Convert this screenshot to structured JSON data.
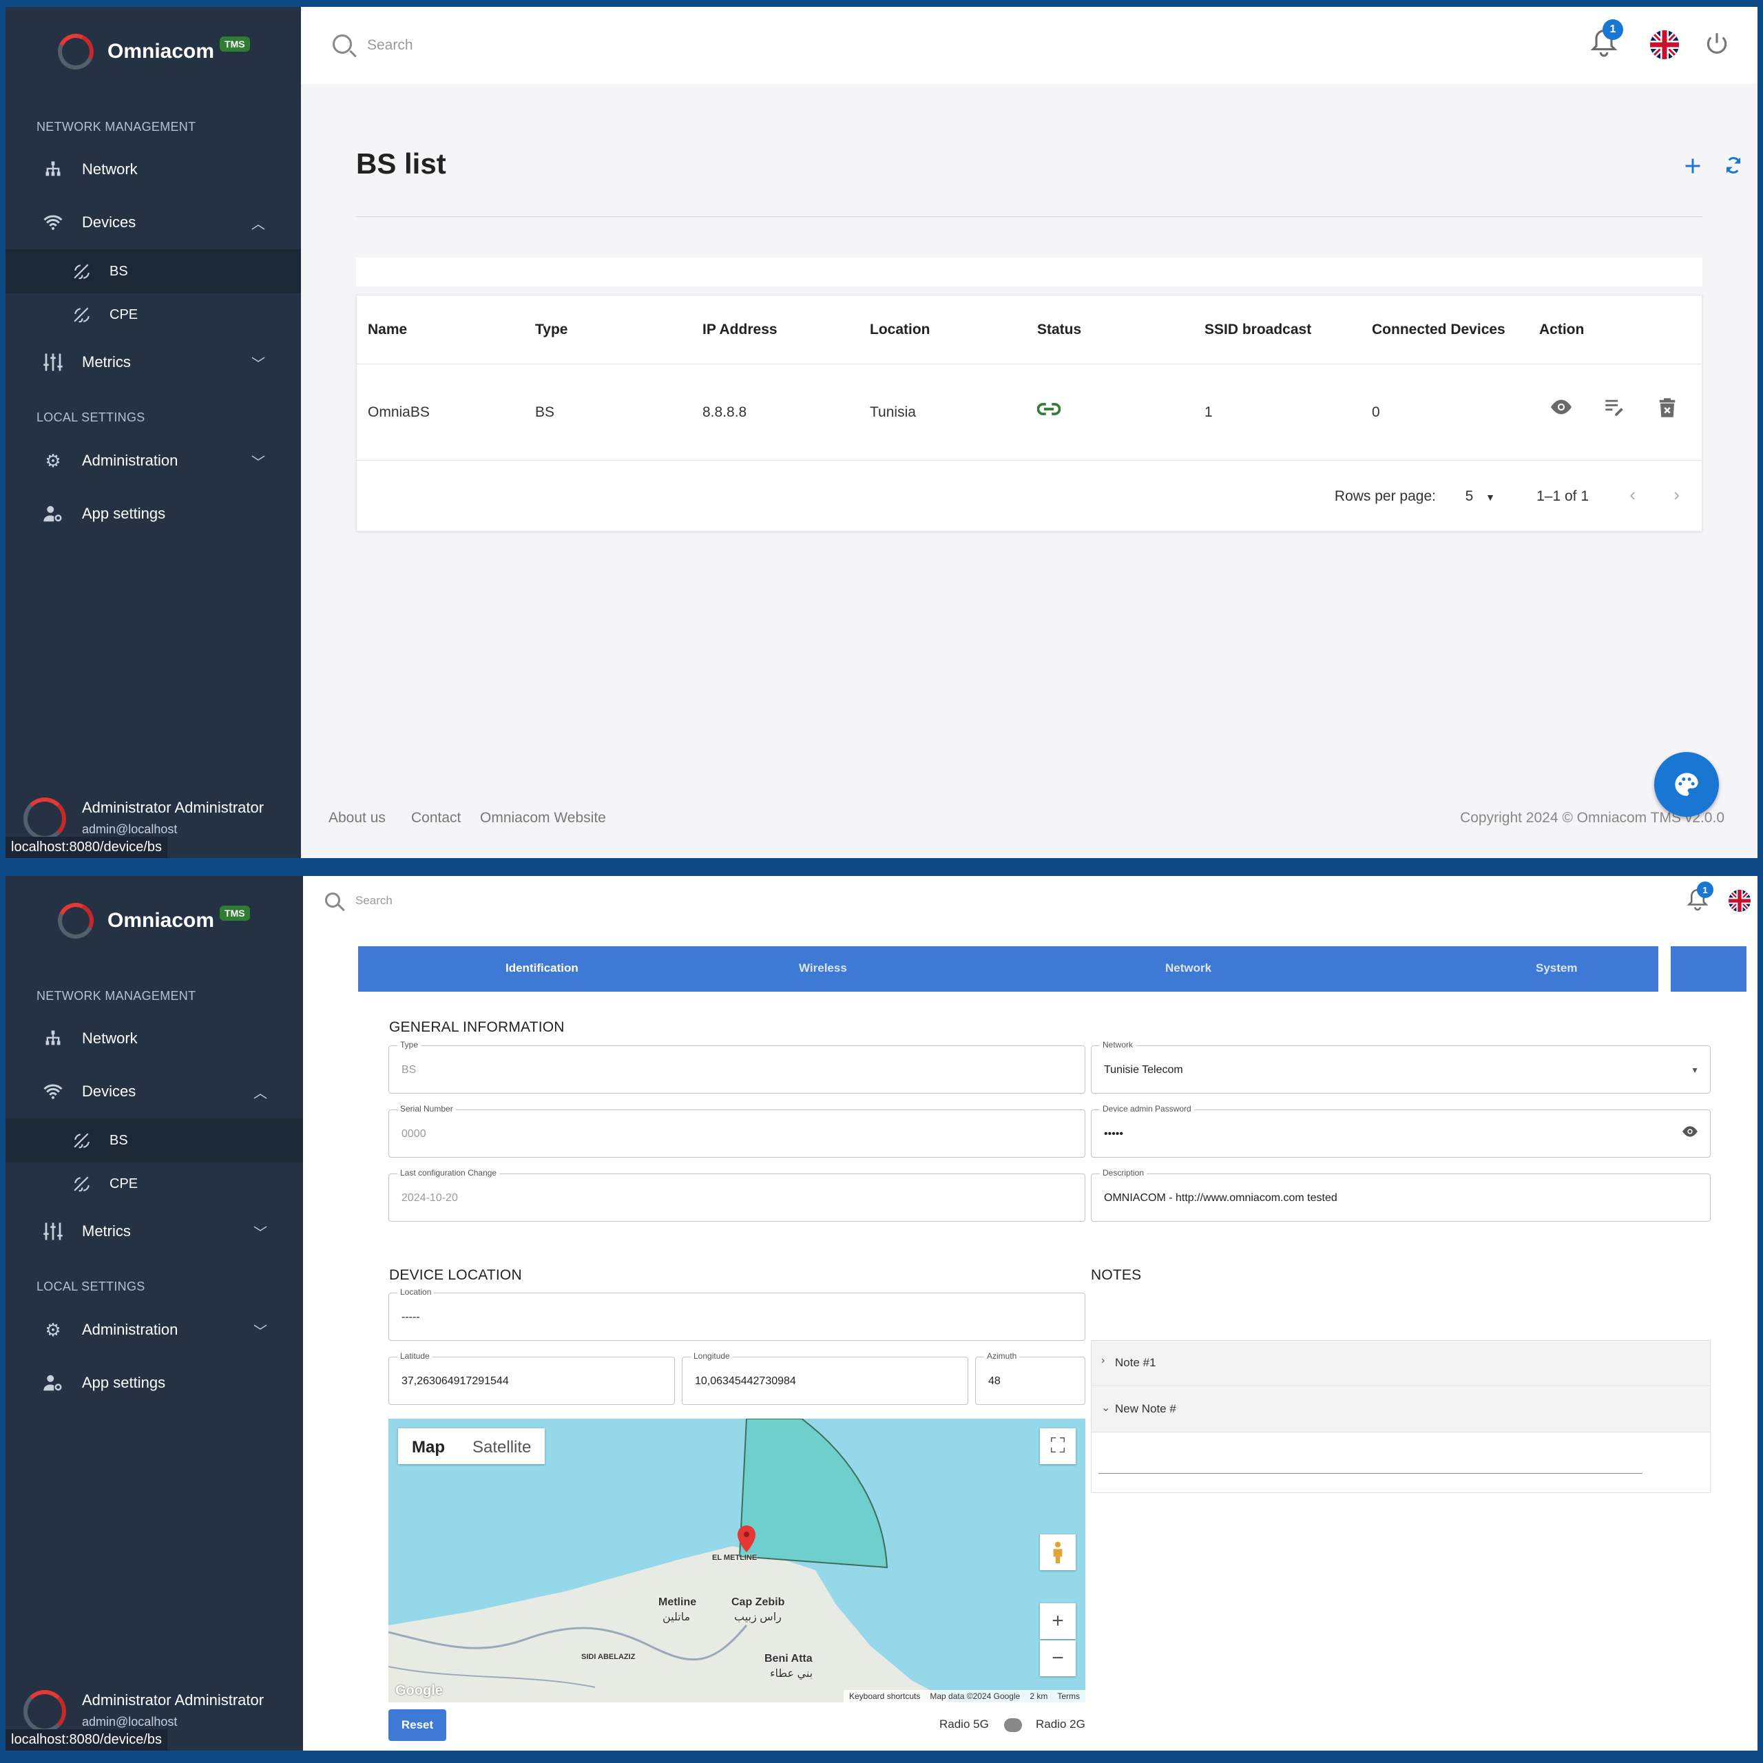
{
  "app": {
    "name": "Omniacom",
    "badge": "TMS"
  },
  "sidebar": {
    "section_network": "NETWORK MANAGEMENT",
    "section_local": "LOCAL SETTINGS",
    "items": {
      "network": "Network",
      "devices": "Devices",
      "bs": "BS",
      "cpe": "CPE",
      "metrics": "Metrics",
      "administration": "Administration",
      "app_settings": "App settings"
    },
    "user": {
      "name": "Administrator Administrator",
      "email": "admin@localhost"
    }
  },
  "status_url": "localhost:8080/device/bs",
  "topbar": {
    "search_placeholder": "Search",
    "notifications": "1"
  },
  "bs_list": {
    "title": "BS list",
    "columns": [
      "Name",
      "Type",
      "IP Address",
      "Location",
      "Status",
      "SSID broadcast",
      "Connected Devices",
      "Action"
    ],
    "rows": [
      {
        "name": "OmniaBS",
        "type": "BS",
        "ip": "8.8.8.8",
        "location": "Tunisia",
        "status": "connected",
        "ssid": "1",
        "connected": "0"
      }
    ],
    "pagination": {
      "rows_label": "Rows per page:",
      "rows_value": "5",
      "range": "1–1 of 1"
    }
  },
  "footer": {
    "links": [
      "About us",
      "Contact",
      "Omniacom Website"
    ],
    "copyright": "Copyright 2024 © Omniacom TMS v2.0.0"
  },
  "detail": {
    "tabs": [
      "Identification",
      "Wireless",
      "Network",
      "System"
    ],
    "general_title": "GENERAL INFORMATION",
    "fields": {
      "type": {
        "label": "Type",
        "value": "BS"
      },
      "serial": {
        "label": "Serial Number",
        "value": "0000"
      },
      "last_change": {
        "label": "Last configuration Change",
        "value": "2024-10-20"
      },
      "network": {
        "label": "Network",
        "value": "Tunisie Telecom"
      },
      "password": {
        "label": "Device admin Password",
        "value": "•••••"
      },
      "description": {
        "label": "Description",
        "value": "OMNIACOM - http://www.omniacom.com tested"
      }
    },
    "location_title": "DEVICE LOCATION",
    "location": {
      "label": "Location",
      "value": "-----"
    },
    "latitude": {
      "label": "Latitude",
      "value": "37,263064917291544"
    },
    "longitude": {
      "label": "Longitude",
      "value": "10,06345442730984"
    },
    "azimuth": {
      "label": "Azimuth",
      "value": "48"
    },
    "notes_title": "NOTES",
    "notes": [
      "Note #1",
      "New Note #"
    ],
    "map": {
      "btn_map": "Map",
      "btn_satellite": "Satellite",
      "labels": {
        "el_metline": "EL METLINE",
        "metline": "Metline",
        "metline_ar": "ماتلين",
        "cap_zebib": "Cap Zebib",
        "cap_zebib_ar": "راس زبيب",
        "sidi": "SIDI ABELAZIZ",
        "beni_atta": "Beni Atta",
        "beni_atta_ar": "بني عطاء",
        "google": "Google"
      },
      "footer": [
        "Keyboard shortcuts",
        "Map data ©2024 Google",
        "2 km",
        "Terms"
      ]
    },
    "reset": "Reset",
    "radio5": "Radio 5G",
    "radio2": "Radio 2G"
  }
}
